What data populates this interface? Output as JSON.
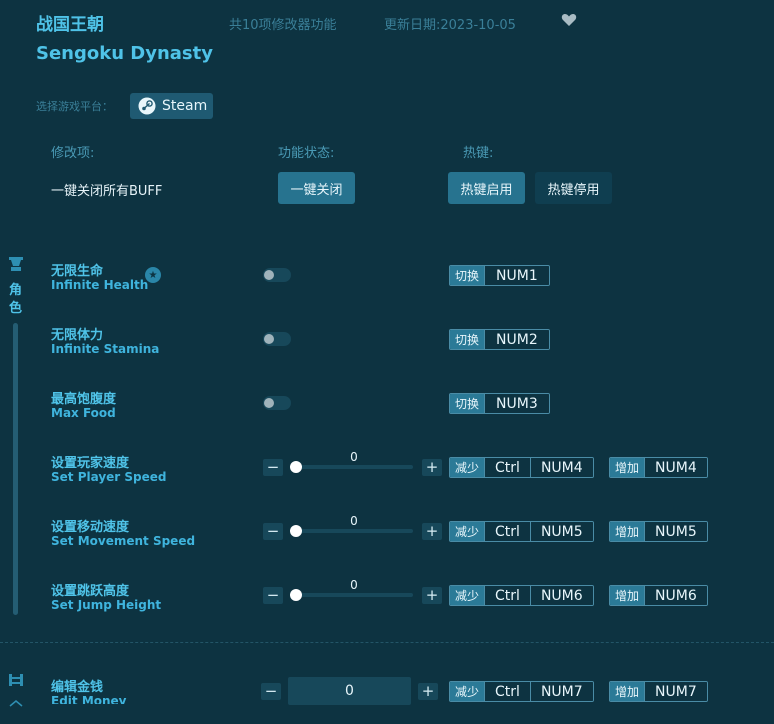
{
  "header": {
    "title_cn": "战国王朝",
    "title_en": "Sengoku Dynasty",
    "feature_count": "共10项修改器功能",
    "update_date": "更新日期:2023-10-05",
    "platform_label": "选择游戏平台：",
    "platform_button": "Steam"
  },
  "columns": {
    "mod": "修改项:",
    "status": "功能状态:",
    "hotkey": "热键:"
  },
  "global_row": {
    "label": "一键关闭所有BUFF",
    "close_all": "一键关闭",
    "hotkey_enable": "热键启用",
    "hotkey_disable": "热键停用"
  },
  "categories": [
    {
      "icon": "character-icon",
      "label_1": "角",
      "label_2": "色"
    },
    {
      "icon": "resource-icon"
    }
  ],
  "features": {
    "f1": {
      "cn": "无限生命",
      "en": "Infinite Health",
      "toggle_tag": "切换",
      "key": "NUM1",
      "on": false
    },
    "f2": {
      "cn": "无限体力",
      "en": "Infinite Stamina",
      "toggle_tag": "切换",
      "key": "NUM2",
      "on": false
    },
    "f3": {
      "cn": "最高饱腹度",
      "en": "Max Food",
      "toggle_tag": "切换",
      "key": "NUM3",
      "on": false
    },
    "f4": {
      "cn": "设置玩家速度",
      "en": "Set Player Speed",
      "value": "0",
      "dec_tag": "减少",
      "inc_tag": "增加",
      "mod": "Ctrl",
      "key": "NUM4",
      "inc_key": "NUM4"
    },
    "f5": {
      "cn": "设置移动速度",
      "en": "Set Movement Speed",
      "value": "0",
      "dec_tag": "减少",
      "inc_tag": "增加",
      "mod": "Ctrl",
      "key": "NUM5",
      "inc_key": "NUM5"
    },
    "f6": {
      "cn": "设置跳跃高度",
      "en": "Set Jump Height",
      "value": "0",
      "dec_tag": "减少",
      "inc_tag": "增加",
      "mod": "Ctrl",
      "key": "NUM6",
      "inc_key": "NUM6"
    },
    "f7": {
      "cn": "编辑金钱",
      "en": "Edit Money",
      "value": "0",
      "dec_tag": "减少",
      "inc_tag": "增加",
      "mod": "Ctrl",
      "key": "NUM7",
      "inc_key": "NUM7"
    }
  },
  "stepper": {
    "minus": "−",
    "plus": "+"
  },
  "colors": {
    "background": "#0d3341",
    "accent": "#4fc3e8",
    "button": "#27738f"
  }
}
